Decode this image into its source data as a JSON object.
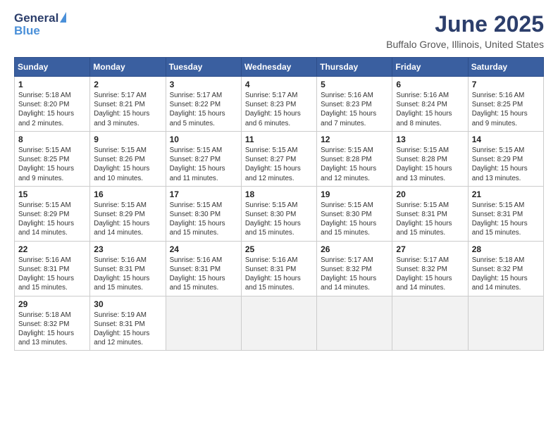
{
  "header": {
    "logo_general": "General",
    "logo_blue": "Blue",
    "main_title": "June 2025",
    "subtitle": "Buffalo Grove, Illinois, United States"
  },
  "calendar": {
    "days_of_week": [
      "Sunday",
      "Monday",
      "Tuesday",
      "Wednesday",
      "Thursday",
      "Friday",
      "Saturday"
    ],
    "weeks": [
      [
        {
          "day": "1",
          "sunrise": "Sunrise: 5:18 AM",
          "sunset": "Sunset: 8:20 PM",
          "daylight": "Daylight: 15 hours and 2 minutes."
        },
        {
          "day": "2",
          "sunrise": "Sunrise: 5:17 AM",
          "sunset": "Sunset: 8:21 PM",
          "daylight": "Daylight: 15 hours and 3 minutes."
        },
        {
          "day": "3",
          "sunrise": "Sunrise: 5:17 AM",
          "sunset": "Sunset: 8:22 PM",
          "daylight": "Daylight: 15 hours and 5 minutes."
        },
        {
          "day": "4",
          "sunrise": "Sunrise: 5:17 AM",
          "sunset": "Sunset: 8:23 PM",
          "daylight": "Daylight: 15 hours and 6 minutes."
        },
        {
          "day": "5",
          "sunrise": "Sunrise: 5:16 AM",
          "sunset": "Sunset: 8:23 PM",
          "daylight": "Daylight: 15 hours and 7 minutes."
        },
        {
          "day": "6",
          "sunrise": "Sunrise: 5:16 AM",
          "sunset": "Sunset: 8:24 PM",
          "daylight": "Daylight: 15 hours and 8 minutes."
        },
        {
          "day": "7",
          "sunrise": "Sunrise: 5:16 AM",
          "sunset": "Sunset: 8:25 PM",
          "daylight": "Daylight: 15 hours and 9 minutes."
        }
      ],
      [
        {
          "day": "8",
          "sunrise": "Sunrise: 5:15 AM",
          "sunset": "Sunset: 8:25 PM",
          "daylight": "Daylight: 15 hours and 9 minutes."
        },
        {
          "day": "9",
          "sunrise": "Sunrise: 5:15 AM",
          "sunset": "Sunset: 8:26 PM",
          "daylight": "Daylight: 15 hours and 10 minutes."
        },
        {
          "day": "10",
          "sunrise": "Sunrise: 5:15 AM",
          "sunset": "Sunset: 8:27 PM",
          "daylight": "Daylight: 15 hours and 11 minutes."
        },
        {
          "day": "11",
          "sunrise": "Sunrise: 5:15 AM",
          "sunset": "Sunset: 8:27 PM",
          "daylight": "Daylight: 15 hours and 12 minutes."
        },
        {
          "day": "12",
          "sunrise": "Sunrise: 5:15 AM",
          "sunset": "Sunset: 8:28 PM",
          "daylight": "Daylight: 15 hours and 12 minutes."
        },
        {
          "day": "13",
          "sunrise": "Sunrise: 5:15 AM",
          "sunset": "Sunset: 8:28 PM",
          "daylight": "Daylight: 15 hours and 13 minutes."
        },
        {
          "day": "14",
          "sunrise": "Sunrise: 5:15 AM",
          "sunset": "Sunset: 8:29 PM",
          "daylight": "Daylight: 15 hours and 13 minutes."
        }
      ],
      [
        {
          "day": "15",
          "sunrise": "Sunrise: 5:15 AM",
          "sunset": "Sunset: 8:29 PM",
          "daylight": "Daylight: 15 hours and 14 minutes."
        },
        {
          "day": "16",
          "sunrise": "Sunrise: 5:15 AM",
          "sunset": "Sunset: 8:29 PM",
          "daylight": "Daylight: 15 hours and 14 minutes."
        },
        {
          "day": "17",
          "sunrise": "Sunrise: 5:15 AM",
          "sunset": "Sunset: 8:30 PM",
          "daylight": "Daylight: 15 hours and 15 minutes."
        },
        {
          "day": "18",
          "sunrise": "Sunrise: 5:15 AM",
          "sunset": "Sunset: 8:30 PM",
          "daylight": "Daylight: 15 hours and 15 minutes."
        },
        {
          "day": "19",
          "sunrise": "Sunrise: 5:15 AM",
          "sunset": "Sunset: 8:30 PM",
          "daylight": "Daylight: 15 hours and 15 minutes."
        },
        {
          "day": "20",
          "sunrise": "Sunrise: 5:15 AM",
          "sunset": "Sunset: 8:31 PM",
          "daylight": "Daylight: 15 hours and 15 minutes."
        },
        {
          "day": "21",
          "sunrise": "Sunrise: 5:15 AM",
          "sunset": "Sunset: 8:31 PM",
          "daylight": "Daylight: 15 hours and 15 minutes."
        }
      ],
      [
        {
          "day": "22",
          "sunrise": "Sunrise: 5:16 AM",
          "sunset": "Sunset: 8:31 PM",
          "daylight": "Daylight: 15 hours and 15 minutes."
        },
        {
          "day": "23",
          "sunrise": "Sunrise: 5:16 AM",
          "sunset": "Sunset: 8:31 PM",
          "daylight": "Daylight: 15 hours and 15 minutes."
        },
        {
          "day": "24",
          "sunrise": "Sunrise: 5:16 AM",
          "sunset": "Sunset: 8:31 PM",
          "daylight": "Daylight: 15 hours and 15 minutes."
        },
        {
          "day": "25",
          "sunrise": "Sunrise: 5:16 AM",
          "sunset": "Sunset: 8:31 PM",
          "daylight": "Daylight: 15 hours and 15 minutes."
        },
        {
          "day": "26",
          "sunrise": "Sunrise: 5:17 AM",
          "sunset": "Sunset: 8:32 PM",
          "daylight": "Daylight: 15 hours and 14 minutes."
        },
        {
          "day": "27",
          "sunrise": "Sunrise: 5:17 AM",
          "sunset": "Sunset: 8:32 PM",
          "daylight": "Daylight: 15 hours and 14 minutes."
        },
        {
          "day": "28",
          "sunrise": "Sunrise: 5:18 AM",
          "sunset": "Sunset: 8:32 PM",
          "daylight": "Daylight: 15 hours and 14 minutes."
        }
      ],
      [
        {
          "day": "29",
          "sunrise": "Sunrise: 5:18 AM",
          "sunset": "Sunset: 8:32 PM",
          "daylight": "Daylight: 15 hours and 13 minutes."
        },
        {
          "day": "30",
          "sunrise": "Sunrise: 5:19 AM",
          "sunset": "Sunset: 8:31 PM",
          "daylight": "Daylight: 15 hours and 12 minutes."
        },
        {
          "day": "",
          "sunrise": "",
          "sunset": "",
          "daylight": ""
        },
        {
          "day": "",
          "sunrise": "",
          "sunset": "",
          "daylight": ""
        },
        {
          "day": "",
          "sunrise": "",
          "sunset": "",
          "daylight": ""
        },
        {
          "day": "",
          "sunrise": "",
          "sunset": "",
          "daylight": ""
        },
        {
          "day": "",
          "sunrise": "",
          "sunset": "",
          "daylight": ""
        }
      ]
    ]
  }
}
